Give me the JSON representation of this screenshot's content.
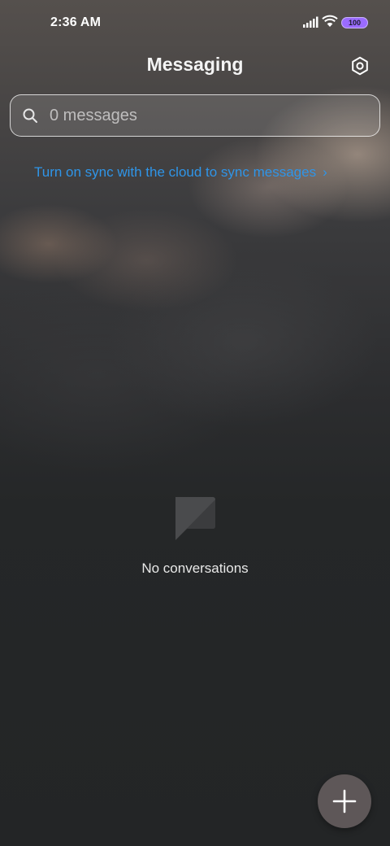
{
  "status_bar": {
    "time": "2:36 AM",
    "battery_level": "100",
    "icons": [
      "signal-icon",
      "wifi-icon",
      "battery-icon"
    ]
  },
  "header": {
    "title": "Messaging",
    "settings_icon": "gear-icon"
  },
  "search": {
    "placeholder": "0 messages",
    "icon": "search-icon"
  },
  "sync_banner": {
    "text": "Turn on sync with the cloud to sync messages",
    "chevron": "›",
    "color": "#2f95e8"
  },
  "empty_state": {
    "icon": "message-bubble-icon",
    "text": "No conversations"
  },
  "fab": {
    "icon": "plus-icon",
    "color": "#5e5758"
  }
}
